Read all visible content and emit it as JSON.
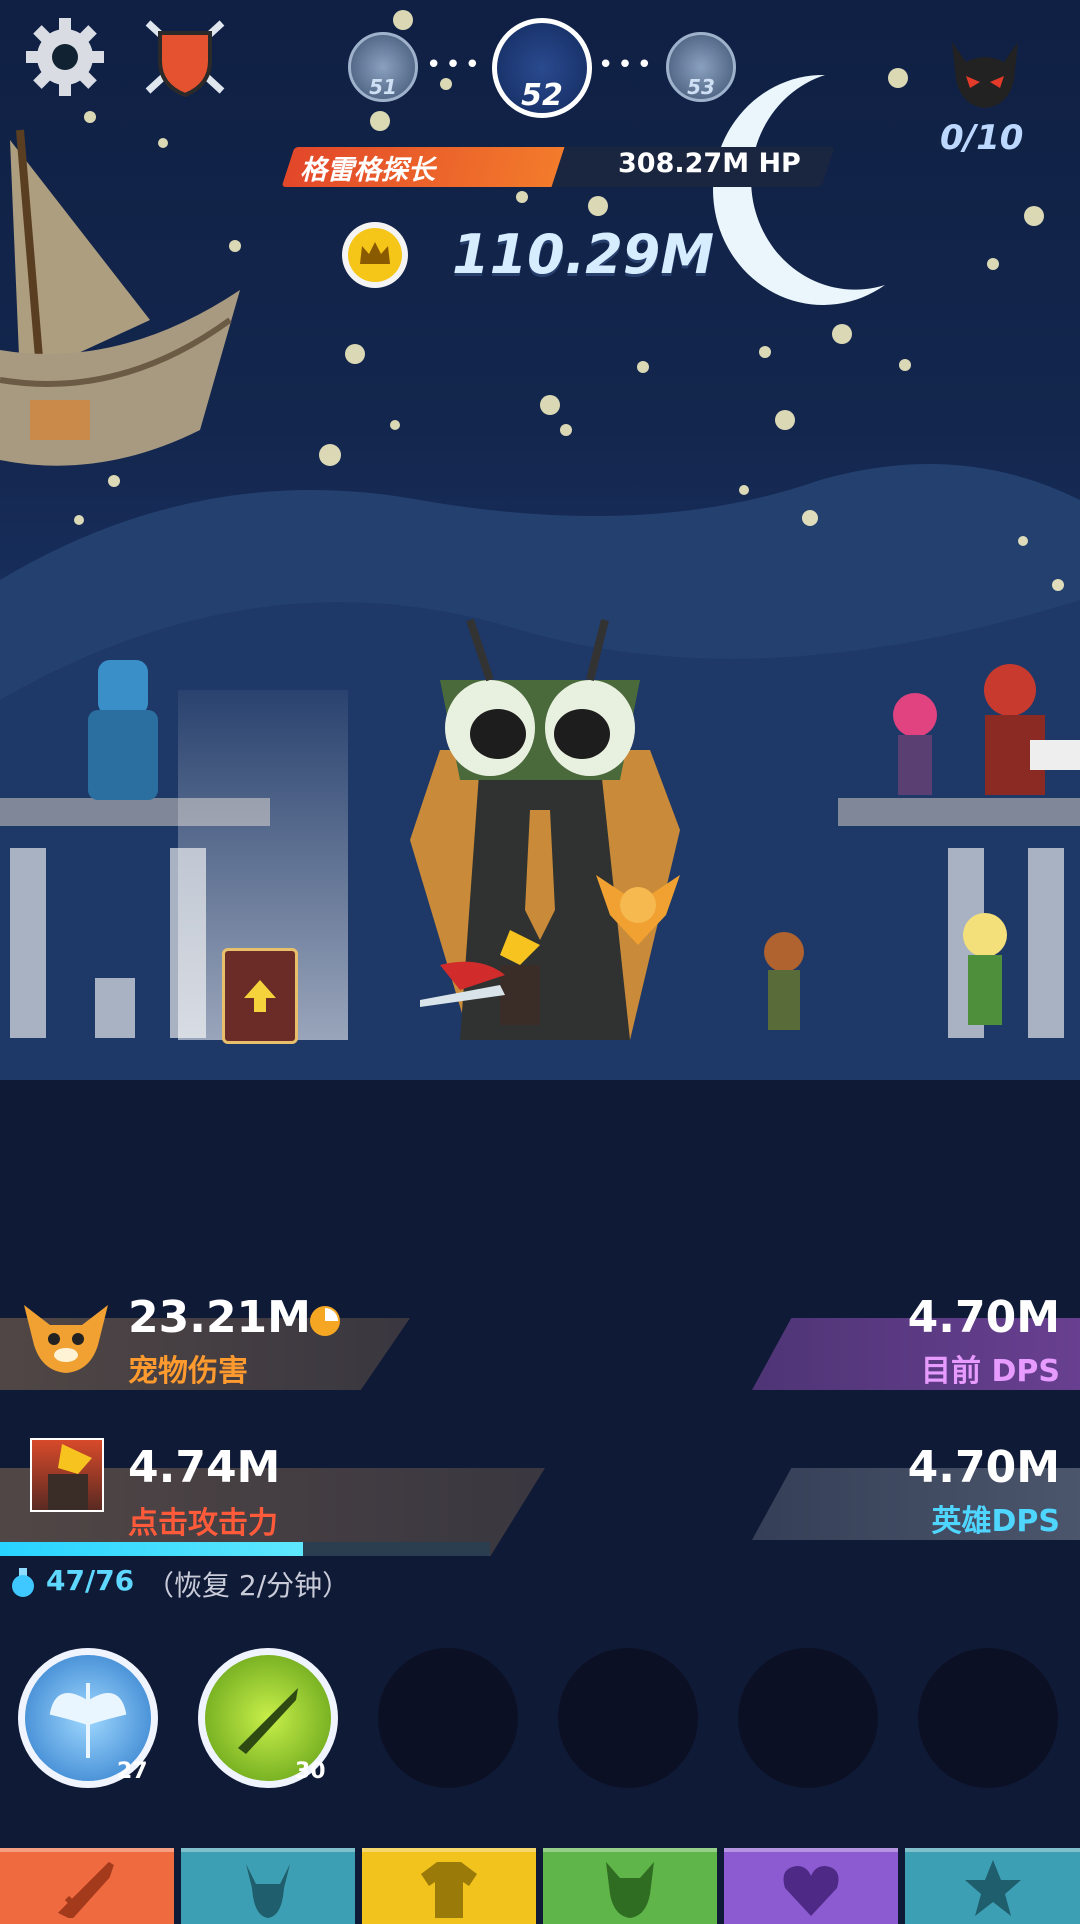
{
  "stages": {
    "prev": "51",
    "current": "52",
    "next": "53"
  },
  "boss": {
    "name": "格雷格探长",
    "hp": "308.27M HP",
    "hp_fraction": 0.5
  },
  "gold": "110.29M",
  "kills": "0/10",
  "pet": {
    "value": "23.21M",
    "label": "宠物伤害"
  },
  "current_dps": {
    "value": "4.70M",
    "label": "目前 DPS"
  },
  "tap": {
    "value": "4.74M",
    "label": "点击攻击力"
  },
  "hero_dps": {
    "value": "4.70M",
    "label": "英雄DPS"
  },
  "mana": {
    "value": "47/76",
    "regen": "（恢复 2/分钟）",
    "fraction": 0.618
  },
  "skills": [
    {
      "icon": "angel-wings-icon",
      "level": "27"
    },
    {
      "icon": "lightning-sword-icon",
      "level": "30"
    }
  ],
  "tabs": [
    {
      "icon": "sword-icon",
      "color": "#ef6a3f"
    },
    {
      "icon": "viking-helmet-icon",
      "color": "#3d9fb3"
    },
    {
      "icon": "shirt-icon",
      "color": "#f2c21d"
    },
    {
      "icon": "pet-icon",
      "color": "#5fb54a"
    },
    {
      "icon": "heart-crest-icon",
      "color": "#8c5bd1"
    },
    {
      "icon": "star-icon",
      "color": "#3d9fb3"
    }
  ]
}
